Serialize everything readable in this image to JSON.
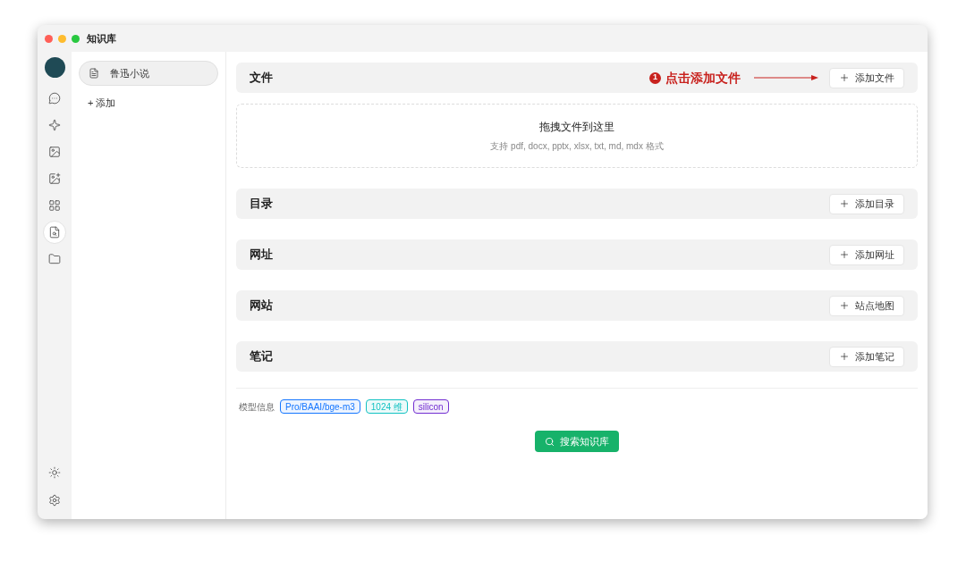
{
  "window": {
    "title": "知识库"
  },
  "rail": {
    "items": [
      {
        "selected": false
      },
      {
        "selected": false
      },
      {
        "selected": false
      },
      {
        "selected": false
      },
      {
        "selected": false
      },
      {
        "selected": true
      },
      {
        "selected": false
      }
    ]
  },
  "knowledge_bases": {
    "items": [
      {
        "label": "鲁迅小说",
        "selected": true
      }
    ],
    "add_label": "+ 添加"
  },
  "sections": [
    {
      "title": "文件",
      "button": "添加文件",
      "annotation": {
        "number": "1",
        "text": "点击添加文件"
      },
      "dropzone": {
        "title": "拖拽文件到这里",
        "hint": "支持 pdf, docx, pptx, xlsx, txt, md, mdx 格式"
      }
    },
    {
      "title": "目录",
      "button": "添加目录"
    },
    {
      "title": "网址",
      "button": "添加网址"
    },
    {
      "title": "网站",
      "button": "站点地图"
    },
    {
      "title": "笔记",
      "button": "添加笔记"
    }
  ],
  "model_info": {
    "label": "模型信息",
    "tags": [
      {
        "text": "Pro/BAAI/bge-m3",
        "color": "#1677ff"
      },
      {
        "text": "1024 维",
        "color": "#13c2c2"
      },
      {
        "text": "silicon",
        "color": "#722ed1"
      }
    ]
  },
  "search_button": "搜索知识库"
}
